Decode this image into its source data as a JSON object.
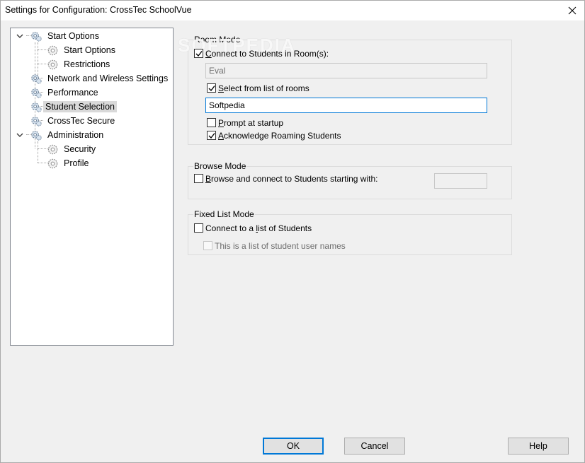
{
  "window": {
    "title": "Settings for Configuration: CrossTec SchoolVue"
  },
  "tree": {
    "items": [
      {
        "label": "Start Options",
        "expanded": true
      },
      {
        "label": "Start Options"
      },
      {
        "label": "Restrictions"
      },
      {
        "label": "Network and Wireless Settings"
      },
      {
        "label": "Performance"
      },
      {
        "label": "Student Selection",
        "selected": true
      },
      {
        "label": "CrossTec Secure"
      },
      {
        "label": "Administration",
        "expanded": true
      },
      {
        "label": "Security"
      },
      {
        "label": "Profile"
      }
    ]
  },
  "room_mode": {
    "title": "Room Mode",
    "connect_checked": true,
    "connect_label_u": "C",
    "connect_label_rest": "onnect to Students in Room(s):",
    "room_field_value": "Eval",
    "select_list_checked": true,
    "select_list_label_u": "S",
    "select_list_label_rest": "elect from list of rooms",
    "room_list_value": "Softpedia",
    "prompt_checked": false,
    "prompt_label_u": "P",
    "prompt_label_rest": "rompt at startup",
    "ack_checked": true,
    "ack_label_u": "A",
    "ack_label_rest": "cknowledge Roaming Students"
  },
  "browse_mode": {
    "title": "Browse Mode",
    "browse_checked": false,
    "browse_label_u": "B",
    "browse_label_rest": "rowse and connect to Students starting with:",
    "browse_field_value": ""
  },
  "fixed_list_mode": {
    "title": "Fixed List Mode",
    "connect_checked": false,
    "connect_label_pre": "Connect to a ",
    "connect_label_u": "l",
    "connect_label_rest": "ist of Students",
    "usernames_checked": false,
    "usernames_label": "This is a list of student user names"
  },
  "buttons": {
    "ok": "OK",
    "cancel": "Cancel",
    "help": "Help"
  },
  "watermark": "SOFTPEDIA",
  "colors": {
    "accent": "#0078d7",
    "selection": "#d9d9d9"
  }
}
